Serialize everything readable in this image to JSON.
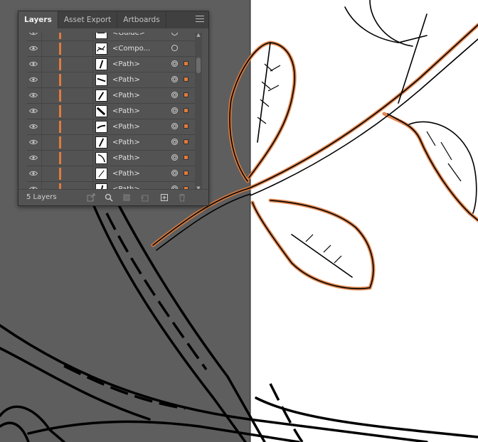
{
  "panel": {
    "tabs": [
      {
        "label": "Layers",
        "active": true
      },
      {
        "label": "Asset Export",
        "active": false
      },
      {
        "label": "Artboards",
        "active": false
      }
    ],
    "footer": {
      "count_label": "5 Layers"
    }
  },
  "layers": [
    {
      "name": "<Guide>",
      "target": "single",
      "selected": false
    },
    {
      "name": "<Compo...",
      "target": "single",
      "selected": false
    },
    {
      "name": "<Path>",
      "target": "double",
      "selected": true
    },
    {
      "name": "<Path>",
      "target": "double",
      "selected": true
    },
    {
      "name": "<Path>",
      "target": "double",
      "selected": true
    },
    {
      "name": "<Path>",
      "target": "double",
      "selected": true
    },
    {
      "name": "<Path>",
      "target": "double",
      "selected": true
    },
    {
      "name": "<Path>",
      "target": "double",
      "selected": true
    },
    {
      "name": "<Path>",
      "target": "double",
      "selected": true
    },
    {
      "name": "<Path>",
      "target": "double",
      "selected": true
    },
    {
      "name": "<Path>",
      "target": "double",
      "selected": true
    }
  ],
  "colors": {
    "layer_color": "#e07b3c",
    "pasteboard": "#5e5e5e",
    "artboard": "#ffffff",
    "outline": "#000000",
    "highlight": "#e07b3c"
  },
  "icons": {
    "visibility": "eye-icon",
    "menu": "hamburger-menu-icon",
    "footer": [
      "export-icon",
      "search-icon",
      "clipping-mask-icon",
      "sublayer-icon",
      "new-layer-icon",
      "trash-icon"
    ]
  }
}
